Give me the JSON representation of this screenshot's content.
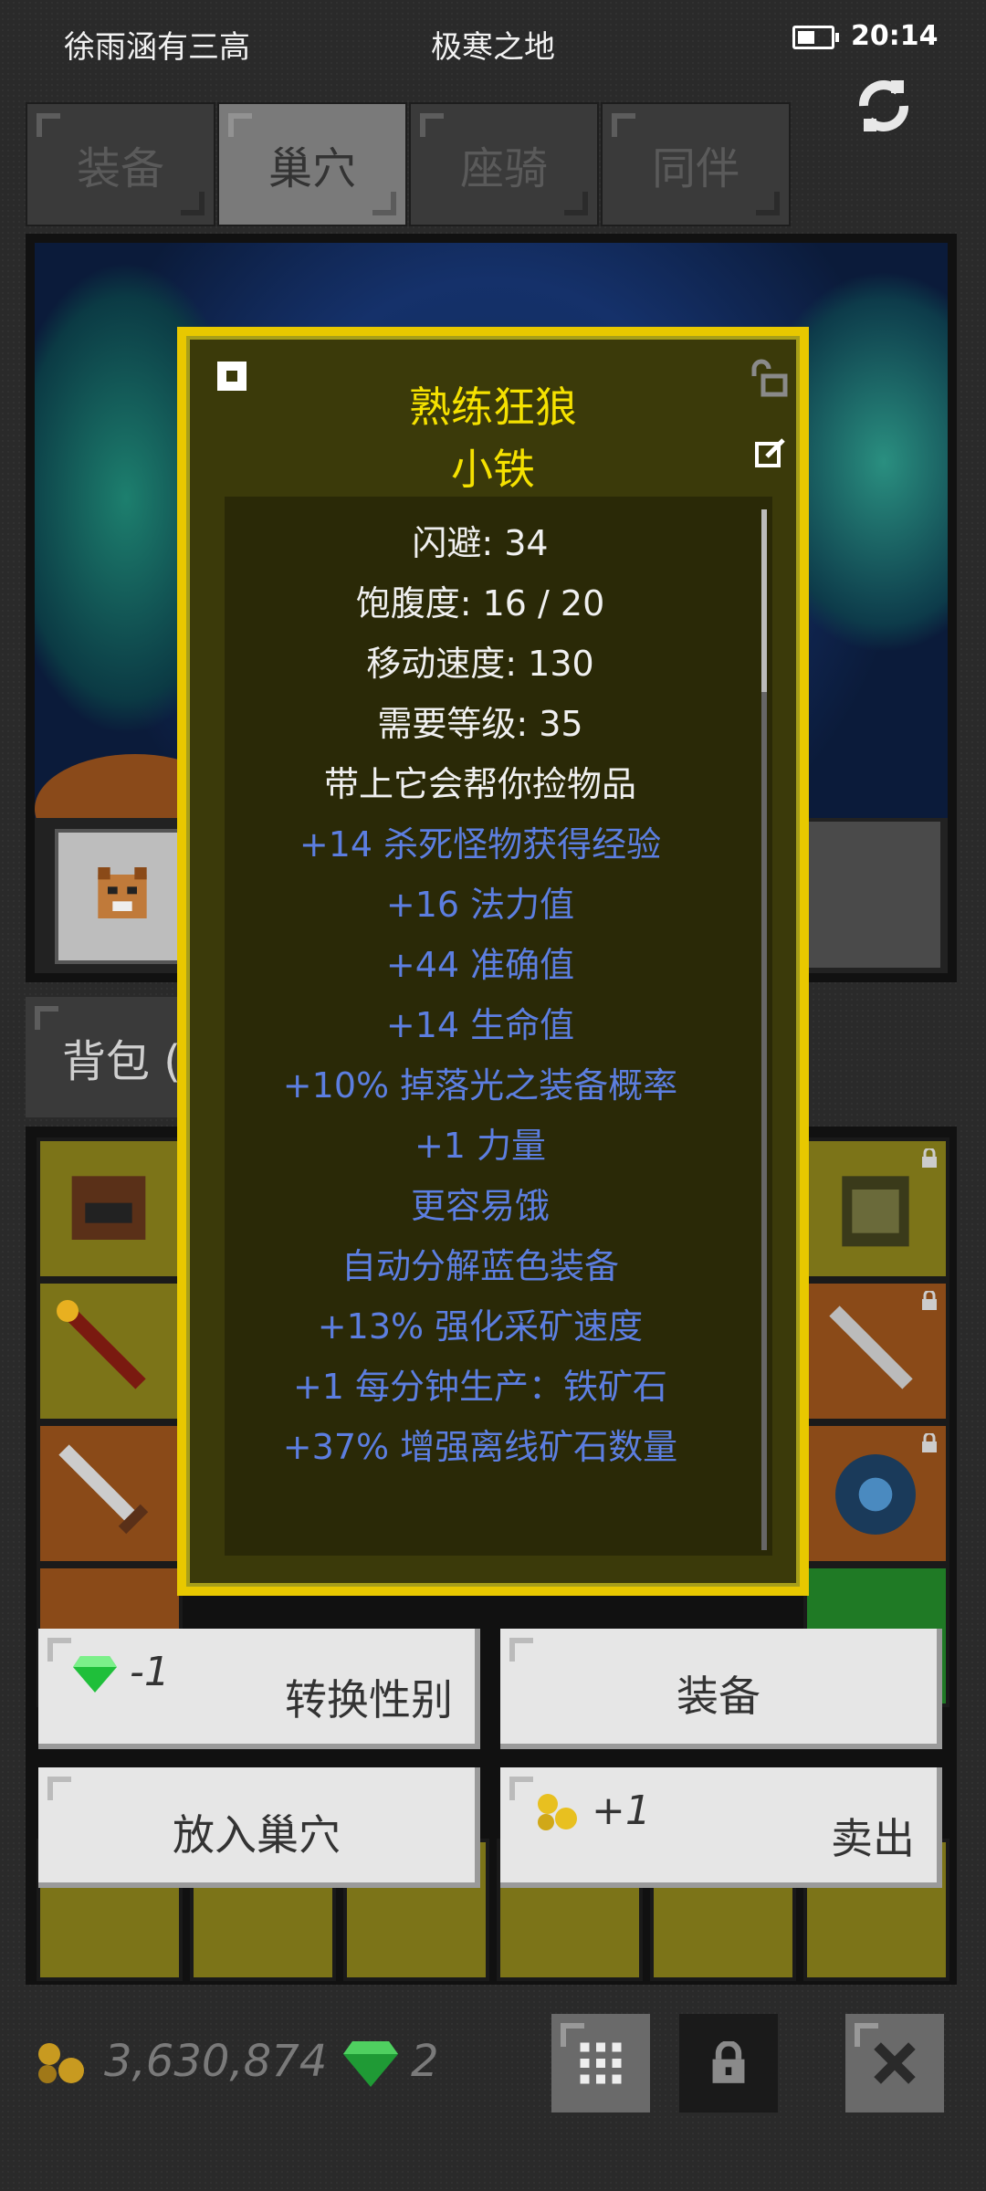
{
  "status_bar": {
    "left_text": "徐雨涵有三高",
    "center_text": "极寒之地",
    "time": "20:14",
    "battery_icon": "battery-icon"
  },
  "tabs": [
    {
      "label": "装备",
      "active": false
    },
    {
      "label": "巢穴",
      "active": true
    },
    {
      "label": "座骑",
      "active": false
    },
    {
      "label": "同伴",
      "active": false
    }
  ],
  "backpack_tab": {
    "label": "背包 ("
  },
  "tooltip": {
    "name": "熟练狂狼",
    "nickname": "小铁",
    "base_stats": [
      "闪避: 34",
      "饱腹度: 16 / 20",
      "移动速度: 130",
      "需要等级: 35",
      "带上它会帮你捡物品"
    ],
    "bonus_stats": [
      "+14 杀死怪物获得经验",
      "+16 法力值",
      "+44 准确值",
      "+14 生命值",
      "+10% 掉落光之装备概率",
      "+1 力量",
      "更容易饿",
      "自动分解蓝色装备",
      "+13% 强化采矿速度",
      "+1 每分钟生产：铁矿石",
      "+37% 增强离线矿石数量"
    ],
    "colors": {
      "title": "#f5e100",
      "base": "#f0f0f0",
      "bonus": "#5c7ee0"
    }
  },
  "actions": {
    "change_gender": {
      "cost": "-1",
      "label": "转换性别"
    },
    "equip": {
      "label": "装备"
    },
    "put_in_nest": {
      "label": "放入巢穴"
    },
    "sell": {
      "gain": "+1",
      "label": "卖出"
    }
  },
  "footer": {
    "gold": "3,630,874",
    "gems": "2"
  }
}
